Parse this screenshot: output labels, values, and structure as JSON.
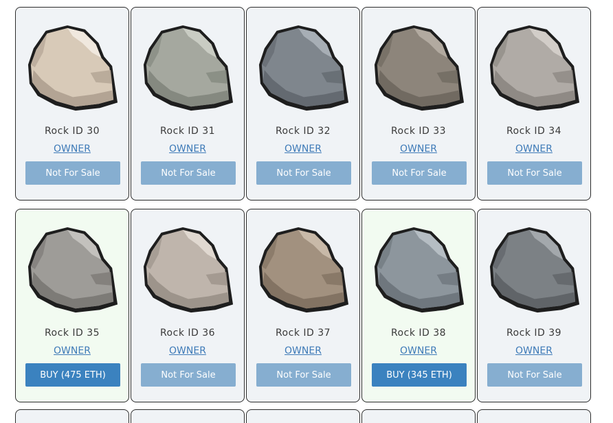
{
  "rocks": [
    {
      "title": "Rock ID 30",
      "owner_label": "OWNER",
      "button_label": "Not For Sale",
      "for_sale": false,
      "color": "#d8cab8",
      "shade": "#b3a494",
      "highlight": "#f0e8de"
    },
    {
      "title": "Rock ID 31",
      "owner_label": "OWNER",
      "button_label": "Not For Sale",
      "for_sale": false,
      "color": "#a5a89f",
      "shade": "#858980",
      "highlight": "#c9ccc3"
    },
    {
      "title": "Rock ID 32",
      "owner_label": "OWNER",
      "button_label": "Not For Sale",
      "for_sale": false,
      "color": "#7f868d",
      "shade": "#646a71",
      "highlight": "#a7aeb5"
    },
    {
      "title": "Rock ID 33",
      "owner_label": "OWNER",
      "button_label": "Not For Sale",
      "for_sale": false,
      "color": "#8d857b",
      "shade": "#716a61",
      "highlight": "#b2aaa0"
    },
    {
      "title": "Rock ID 34",
      "owner_label": "OWNER",
      "button_label": "Not For Sale",
      "for_sale": false,
      "color": "#b0aba6",
      "shade": "#8f8a85",
      "highlight": "#d2cdc8"
    },
    {
      "title": "Rock ID 35",
      "owner_label": "OWNER",
      "button_label": "BUY (475 ETH)",
      "for_sale": true,
      "color": "#9e9c98",
      "shade": "#7d7b77",
      "highlight": "#c3c1bd"
    },
    {
      "title": "Rock ID 36",
      "owner_label": "OWNER",
      "button_label": "Not For Sale",
      "for_sale": false,
      "color": "#bfb5ac",
      "shade": "#9d948b",
      "highlight": "#e0d8d0"
    },
    {
      "title": "Rock ID 37",
      "owner_label": "OWNER",
      "button_label": "Not For Sale",
      "for_sale": false,
      "color": "#a2917f",
      "shade": "#837363",
      "highlight": "#c8b9a8"
    },
    {
      "title": "Rock ID 38",
      "owner_label": "OWNER",
      "button_label": "BUY (345 ETH)",
      "for_sale": true,
      "color": "#8d969d",
      "shade": "#6f777e",
      "highlight": "#b5bdc3"
    },
    {
      "title": "Rock ID 39",
      "owner_label": "OWNER",
      "button_label": "Not For Sale",
      "for_sale": false,
      "color": "#7c8185",
      "shade": "#606468",
      "highlight": "#a3a8ac"
    }
  ],
  "colors": {
    "not_for_sale_button": "#86aed0",
    "buy_button": "#3b82bf",
    "owner_link": "#3f7bb8",
    "card_background": "#f0f3f6",
    "for_sale_card_background": "#f2fbf1"
  }
}
